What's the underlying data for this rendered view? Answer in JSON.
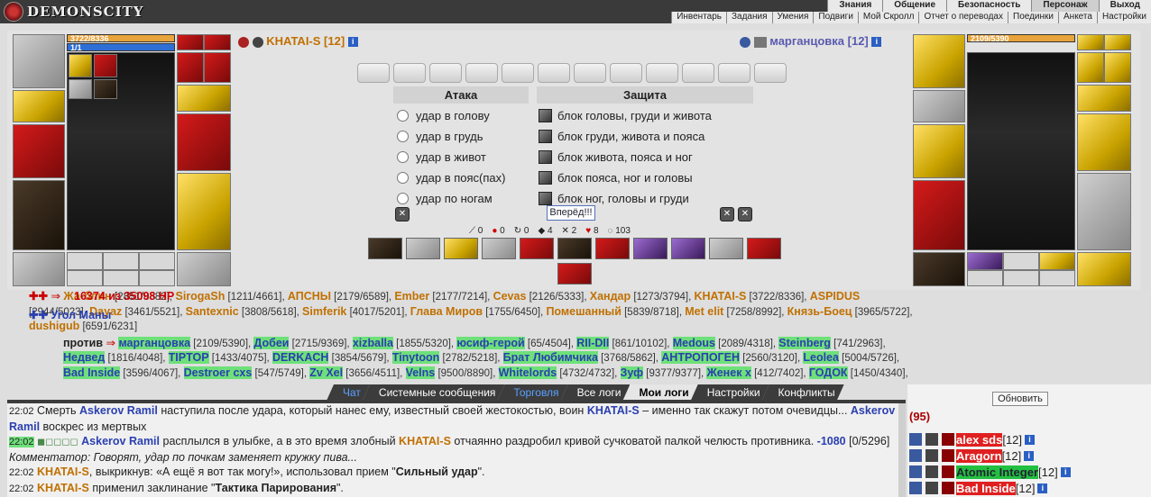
{
  "logo": {
    "text": "DEMONSCITY"
  },
  "topmenu": [
    "Знания",
    "Общение",
    "Безопасность",
    "Персонаж",
    "Выход"
  ],
  "submenu": [
    "Инвентарь",
    "Задания",
    "Умения",
    "Подвиги",
    "Мой Скролл",
    "Отчет о переводах",
    "Поединки",
    "Анкета",
    "Настройки"
  ],
  "left_player": {
    "name": "KHATAI-S [12]",
    "hp": "3722/8336",
    "mp": "1/1",
    "hp_fraction": 0.45
  },
  "right_player": {
    "name": "марганцовка [12]",
    "hp": "2109/5390",
    "hp_fraction": 0.39
  },
  "attack": {
    "header": "Атака",
    "options": [
      "удар в голову",
      "удар в грудь",
      "удар в живот",
      "удар в пояс(пах)",
      "удар по ногам"
    ]
  },
  "defense": {
    "header": "Защита",
    "options": [
      "блок головы, груди и живота",
      "блок груди, живота и пояса",
      "блок живота, пояса и ног",
      "блок пояса, ног и головы",
      "блок ног, головы и груди"
    ]
  },
  "forward_button": "Вперёд!!!",
  "stats": [
    "0",
    "0",
    "0",
    "4",
    "2",
    "8",
    "103"
  ],
  "team_left": {
    "hp_line": "16374 из 35098 HP",
    "captain_line_prefix": "Жа-блин",
    "captain_line_prefix_num": "[2851/8382],",
    "mana_line": "Угол Маны",
    "members": [
      {
        "name": "SirogaSh",
        "hp": "[1211/4661],"
      },
      {
        "name": "АПСНЫ",
        "hp": "[2179/6589],"
      },
      {
        "name": "Ember",
        "hp": "[2177/7214],"
      },
      {
        "name": "Cevas",
        "hp": "[2126/5333],"
      },
      {
        "name": "Хандар",
        "hp": "[1273/3794],"
      },
      {
        "name": "KHATAI-S",
        "hp": "[3722/8336],"
      },
      {
        "name": "ASPIDUS",
        "hp": "[2944/5023],"
      },
      {
        "name": "Dayaz",
        "hp": "[3461/5521],"
      },
      {
        "name": "Santexnic",
        "hp": "[3808/5618],"
      },
      {
        "name": "Simferik",
        "hp": "[4017/5201],"
      },
      {
        "name": "Глава Миров",
        "hp": "[1755/6450],"
      },
      {
        "name": "Помешанный",
        "hp": "[5839/8718],"
      },
      {
        "name": "Met elit",
        "hp": "[7258/8992],"
      },
      {
        "name": "Князь-Боец",
        "hp": "[3965/5722],"
      },
      {
        "name": "dushigub",
        "hp": "[6591/6231]"
      }
    ]
  },
  "vs_label": "против",
  "team_right": {
    "members": [
      {
        "name": "марганцовка",
        "hp": "[2109/5390],"
      },
      {
        "name": "Добеи",
        "hp": "[2715/9369],"
      },
      {
        "name": "xizballa",
        "hp": "[1855/5320],"
      },
      {
        "name": "юсиф-герой",
        "hp": "[65/4504],"
      },
      {
        "name": "RII-DII",
        "hp": "[861/10102],"
      },
      {
        "name": "Medous",
        "hp": "[2089/4318],"
      },
      {
        "name": "Steinberg",
        "hp": "[741/2963],"
      },
      {
        "name": "Недвед",
        "hp": "[1816/4048],"
      },
      {
        "name": "TIPTOP",
        "hp": "[1433/4075],"
      },
      {
        "name": "DERKACH",
        "hp": "[3854/5679],"
      },
      {
        "name": "Tinytoon",
        "hp": "[2782/5218],"
      },
      {
        "name": "Брат Любимчика",
        "hp": "[3768/5862],"
      },
      {
        "name": "АНТРОПОГЕН",
        "hp": "[2560/3120],"
      },
      {
        "name": "Leolea",
        "hp": "[5004/5726],"
      },
      {
        "name": "Bad Inside",
        "hp": "[3596/4067],"
      },
      {
        "name": "Destroer cxs",
        "hp": "[547/5749],"
      },
      {
        "name": "Zv Xel",
        "hp": "[3656/4511],"
      },
      {
        "name": "Velns",
        "hp": "[9500/8890],"
      },
      {
        "name": "Whitelords",
        "hp": "[4732/4732],"
      },
      {
        "name": "Зуф",
        "hp": "[9377/9377],"
      },
      {
        "name": "Женек x",
        "hp": "[412/7402],"
      },
      {
        "name": "ГОДОК",
        "hp": "[1450/4340],"
      }
    ]
  },
  "chat_tabs": [
    "Чат",
    "Системные сообщения",
    "Торговля",
    "Все логи",
    "Мои логи",
    "Настройки",
    "Конфликты"
  ],
  "log": [
    {
      "time": "22:02",
      "text1": "Смерть",
      "name1": "Askerov Ramil",
      "text2": "наступила после удара, который нанес ему, известный своей жестокостью, воин",
      "name2": "KHATAI-S",
      "text3": "– именно так скажут потом очевидцы...",
      "name3": "Askerov Ramil",
      "text4": "воскрес из мертвых"
    },
    {
      "time": "22:02",
      "name1": "Askerov Ramil",
      "text1": "расплылся в улыбке, а в это время злобный",
      "name2": "KHATAI-S",
      "text2": "отчаянно раздробил кривой сучковатой палкой челюсть противника.",
      "dmg": "-1080",
      "hp": "[0/5296]"
    },
    {
      "comment": "Комментатор: Говорят, удар по почкам заменяет кружку пива..."
    },
    {
      "time": "22:02",
      "name1": "KHATAI-S",
      "text1": ", выкрикнув: «А ещё я вот так могу!», использовал прием \"",
      "skill": "Сильный удар",
      "text2": "\"."
    },
    {
      "time": "22:02",
      "name1": "KHATAI-S",
      "text1": "применил заклинание \"",
      "skill": "Тактика Парирования",
      "text2": "\"."
    }
  ],
  "right_panel": {
    "refresh": "Обновить",
    "count": "(95)",
    "players": [
      {
        "name": "alex sds",
        "level": "[12]",
        "hl": "red"
      },
      {
        "name": "Aragorn",
        "level": "[12]",
        "hl": "red"
      },
      {
        "name": "Atomic Integer",
        "level": "[12]",
        "hl": "green"
      },
      {
        "name": "Bad Inside",
        "level": "[12]",
        "hl": "red"
      }
    ]
  }
}
